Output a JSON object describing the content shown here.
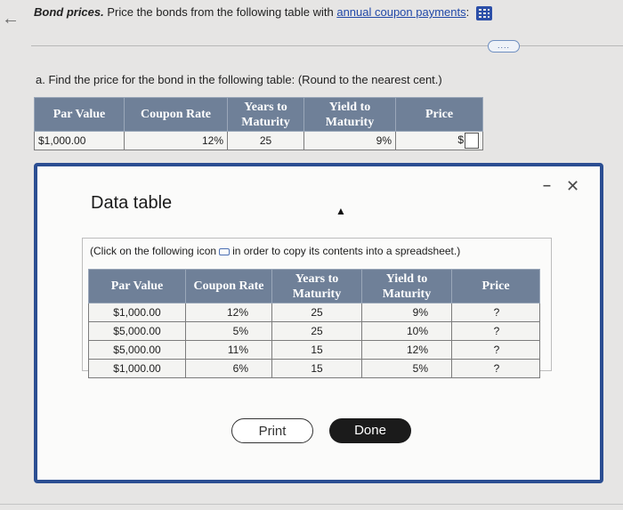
{
  "header": {
    "title_bold": "Bond prices.",
    "instruction_before_link": " Price the bonds from the following table with ",
    "instruction_link": "annual coupon payments",
    "instruction_after": ":",
    "data_icon": "grid-data-icon"
  },
  "more_button_label": "....",
  "question": {
    "text": "a. Find the price for the bond in the following table:  (Round to the nearest cent.)"
  },
  "main_table": {
    "headers": [
      "Par Value",
      "Coupon Rate",
      "Years to Maturity",
      "Yield to Maturity",
      "Price"
    ],
    "row": {
      "par_value": "$1,000.00",
      "coupon_rate": "12%",
      "years": "25",
      "yield": "9%",
      "price_prefix": "$",
      "price_value": ""
    }
  },
  "modal": {
    "title": "Data table",
    "minimize_label": "–",
    "close_label": "✕",
    "note_before": "(Click on the following icon",
    "note_after": "in order to copy its contents into a spreadsheet.)",
    "table": {
      "headers": [
        "Par Value",
        "Coupon Rate",
        "Years to Maturity",
        "Yield to Maturity",
        "Price"
      ],
      "rows": [
        {
          "par": "$1,000.00",
          "coupon": "12%",
          "years": "25",
          "yield": "9%",
          "price": "?"
        },
        {
          "par": "$5,000.00",
          "coupon": "5%",
          "years": "25",
          "yield": "10%",
          "price": "?"
        },
        {
          "par": "$5,000.00",
          "coupon": "11%",
          "years": "15",
          "yield": "12%",
          "price": "?"
        },
        {
          "par": "$1,000.00",
          "coupon": "6%",
          "years": "15",
          "yield": "5%",
          "price": "?"
        }
      ]
    },
    "print_label": "Print",
    "done_label": "Done"
  }
}
